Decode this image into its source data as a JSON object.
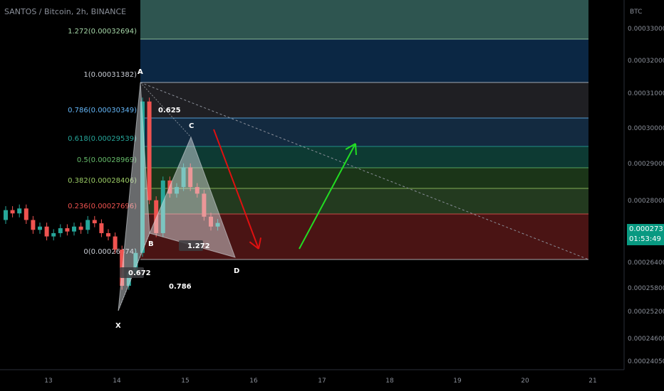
{
  "header": {
    "symbol": "SANTOS / Bitcoin, 2h, BINANCE"
  },
  "axis": {
    "currency": "BTC",
    "price_ticks": [
      "0.00033000",
      "0.00032000",
      "0.00031000",
      "0.00030000",
      "0.00029000",
      "0.00028000",
      "0.00026400",
      "0.00025800",
      "0.00025200",
      "0.00024600",
      "0.00024050"
    ],
    "date_ticks": [
      "13",
      "14",
      "15",
      "16",
      "17",
      "18",
      "19",
      "20",
      "21"
    ]
  },
  "last_price": {
    "price": "0.00027315",
    "countdown": "01:53:49"
  },
  "fib_levels": [
    {
      "label": "1.272(0.00032694)",
      "color": "#a5d6a7"
    },
    {
      "label": "1(0.00031382)",
      "color": "#c8ccd4"
    },
    {
      "label": "0.786(0.00030349)",
      "color": "#64b5f6"
    },
    {
      "label": "0.618(0.00029539)",
      "color": "#26a69a"
    },
    {
      "label": "0.5(0.00028969)",
      "color": "#66bb6a"
    },
    {
      "label": "0.382(0.00028406)",
      "color": "#9ccc65"
    },
    {
      "label": "0.236(0.00027696)",
      "color": "#ef5350"
    },
    {
      "label": "0(0.00026474)",
      "color": "#c8ccd4"
    }
  ],
  "pattern_labels": {
    "x": "X",
    "a": "A",
    "b": "B",
    "c": "C",
    "d": "D",
    "r_xb": "0.672",
    "r_ac": "0.786",
    "r_bd": "1.272",
    "r_xd": "0.625"
  },
  "colors": {
    "up": "#26a69a",
    "down": "#ef5350",
    "bull_arrow": "#22dd22",
    "bear_arrow": "#e01010",
    "price_tag": "#089981"
  },
  "chart_data": {
    "type": "candlestick",
    "symbol": "SANTOS/BTC",
    "timeframe": "2h",
    "ylim": [
      0.0002405,
      0.00033
    ],
    "candles_close": [
      0.000277,
      0.000276,
      0.0002775,
      0.000274,
      0.000271,
      0.000272,
      0.000269,
      0.00027,
      0.0002715,
      0.0002705,
      0.000272,
      0.000271,
      0.000274,
      0.000273,
      0.00027,
      0.000269,
      0.000265,
      0.000254,
      0.000258,
      0.000264,
      0.00031,
      0.00028,
      0.00027,
      0.000286,
      0.000282,
      0.000284,
      0.00029,
      0.000284,
      0.000282,
      0.000275,
      0.000272,
      0.0002731
    ],
    "harmonic_points": {
      "X": 0.0002525,
      "A": 0.00031382,
      "B": 0.000272,
      "C": 0.000297,
      "D": 0.00026474
    }
  }
}
